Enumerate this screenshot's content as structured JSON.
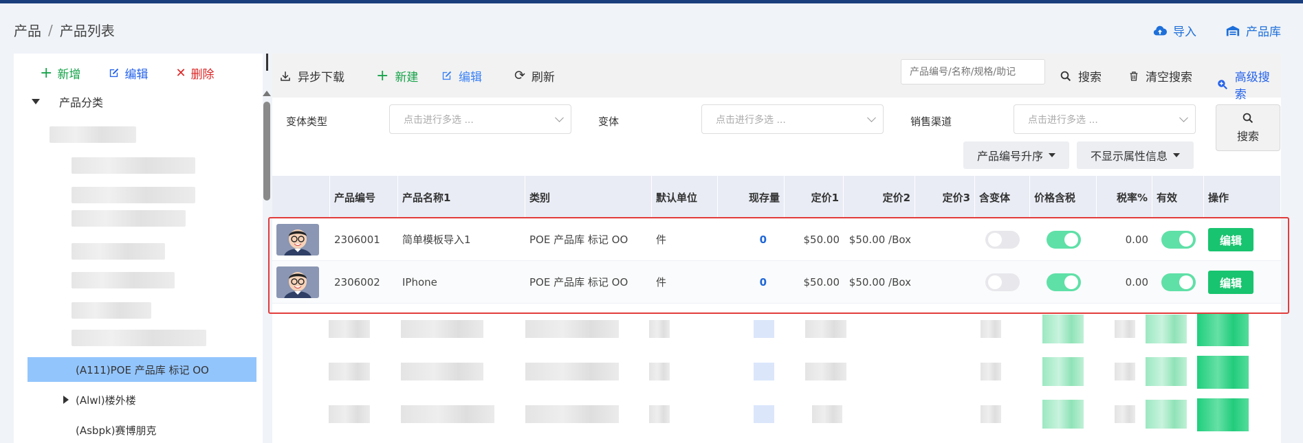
{
  "breadcrumb": {
    "root": "产品",
    "separator": "/",
    "current": "产品列表"
  },
  "header_actions": {
    "import": "导入",
    "library": "产品库"
  },
  "left": {
    "add": "新增",
    "edit": "编辑",
    "delete": "删除",
    "tree_root": "产品分类",
    "nodes": [
      {
        "label": "(A111)POE 产品库 标记 OO"
      },
      {
        "label": "(Alwl)楼外楼"
      },
      {
        "label": "(Asbpk)赛博朋克"
      }
    ]
  },
  "toolbar": {
    "download": "异步下载",
    "new": "新建",
    "edit": "编辑",
    "refresh": "刷新",
    "search_placeholder": "产品编号/名称/规格/助记",
    "search": "搜索",
    "clear": "清空搜索",
    "advanced": "高级搜索"
  },
  "filters": {
    "variant_type": "变体类型",
    "variant": "变体",
    "channel": "销售渠道",
    "placeholder": "点击进行多选 ...",
    "search": "搜索",
    "sort": "产品编号升序",
    "attr": "不显示属性信息"
  },
  "table": {
    "headers": [
      "产品编号",
      "产品名称1",
      "类别",
      "默认单位",
      "现存量",
      "定价1",
      "定价2",
      "定价3",
      "含变体",
      "价格含税",
      "税率%",
      "有效",
      "操作"
    ],
    "rows": [
      {
        "code": "2306001",
        "name": "简单模板导入1",
        "category": "POE 产品库 标记 OO",
        "unit": "件",
        "stock": "0",
        "price1": "$50.00",
        "price2": "$50.00 /Box",
        "price3": "",
        "variant": false,
        "tax_included": true,
        "tax_rate": "0.00",
        "valid": true,
        "action": "编辑"
      },
      {
        "code": "2306002",
        "name": "IPhone",
        "category": "POE 产品库 标记 OO",
        "unit": "件",
        "stock": "0",
        "price1": "$50.00",
        "price2": "$50.00 /Box",
        "price3": "",
        "variant": false,
        "tax_included": true,
        "tax_rate": "0.00",
        "valid": true,
        "action": "编辑"
      }
    ]
  },
  "colors": {
    "accent": "#1e6fd9",
    "success": "#18c46f",
    "danger": "#e23b3b",
    "selected": "#93c5fd"
  }
}
